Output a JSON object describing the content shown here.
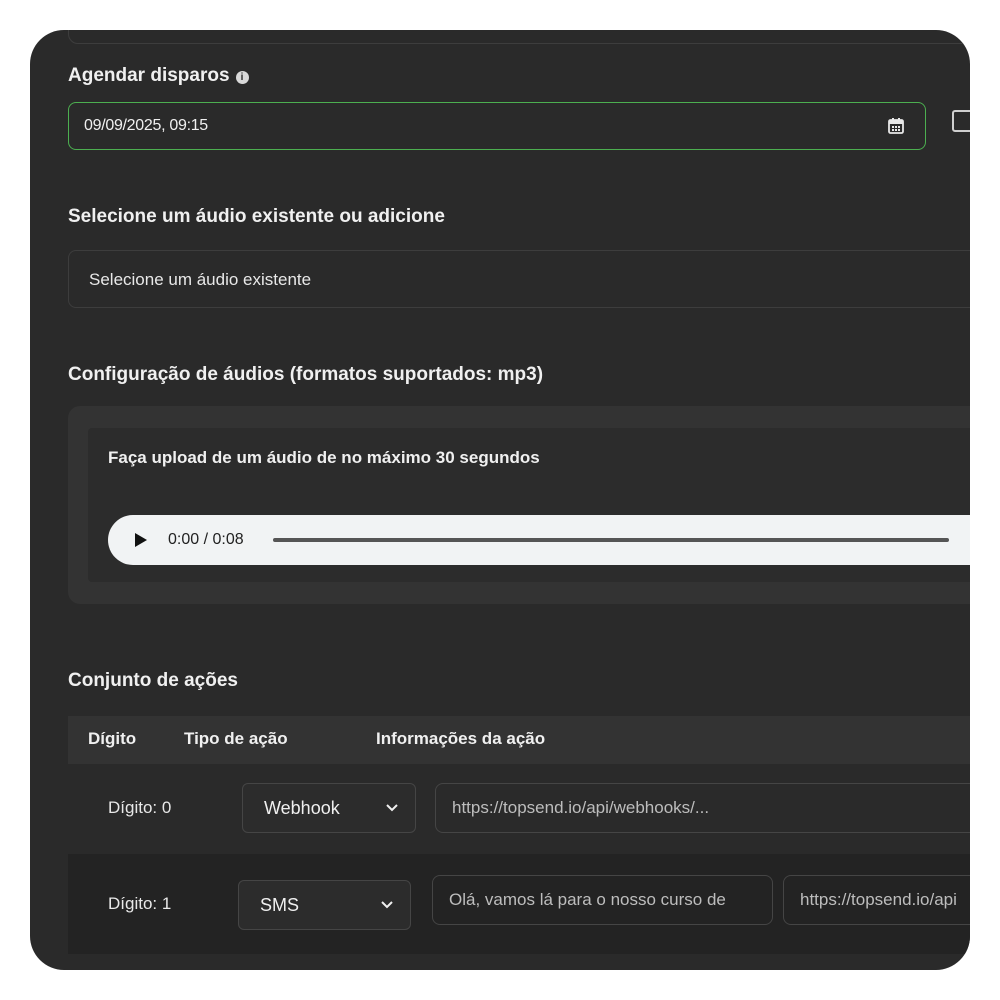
{
  "schedule": {
    "label": "Agendar disparos",
    "info_icon": "i",
    "datetime_value": "09/09/2025, 09:15"
  },
  "audio_select": {
    "label": "Selecione um áudio existente ou adicione",
    "selected": "Selecione um áudio existente"
  },
  "audio_config": {
    "label": "Configuração de áudios (formatos suportados: mp3)",
    "upload_hint": "Faça upload de um áudio de no máximo 30 segundos",
    "player_time": "0:00 / 0:08"
  },
  "actions": {
    "label": "Conjunto de ações",
    "columns": [
      "Dígito",
      "Tipo de ação",
      "Informações da ação"
    ],
    "rows": [
      {
        "digit": "Dígito: 0",
        "type": "Webhook",
        "info": [
          "https://topsend.io/api/webhooks/..."
        ]
      },
      {
        "digit": "Dígito: 1",
        "type": "SMS",
        "info": [
          "Olá, vamos lá para o nosso curso de",
          "https://topsend.io/api"
        ]
      }
    ]
  },
  "colors": {
    "background": "#2a2a2a",
    "accent_border": "#4caf50",
    "text": "#f0f0f0"
  }
}
